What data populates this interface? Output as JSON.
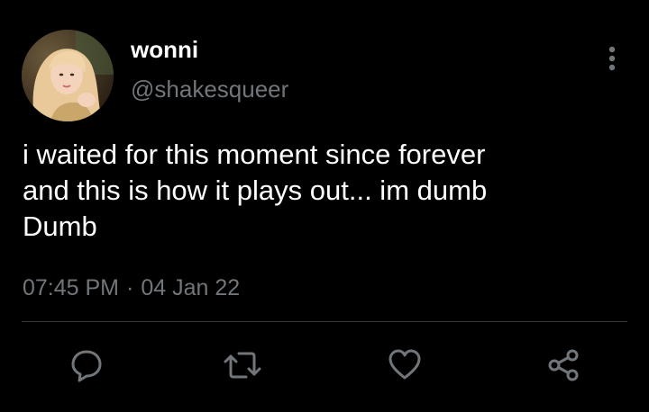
{
  "author": {
    "display_name": "wonni",
    "handle": "@shakesqueer",
    "avatar_icon": "profile-photo"
  },
  "tweet": {
    "lines": [
      "i waited for this moment since forever",
      "and this is how it plays out... im dumb",
      "Dumb"
    ],
    "time": "07:45 PM",
    "separator": "·",
    "date": "04 Jan 22"
  },
  "actions": {
    "reply_icon": "reply-icon",
    "retweet_icon": "retweet-icon",
    "like_icon": "heart-icon",
    "share_icon": "share-icon",
    "more_icon": "more-vertical-icon"
  },
  "colors": {
    "background": "#000000",
    "text": "#ffffff",
    "secondary": "#71767b",
    "divider": "#2f3336"
  }
}
